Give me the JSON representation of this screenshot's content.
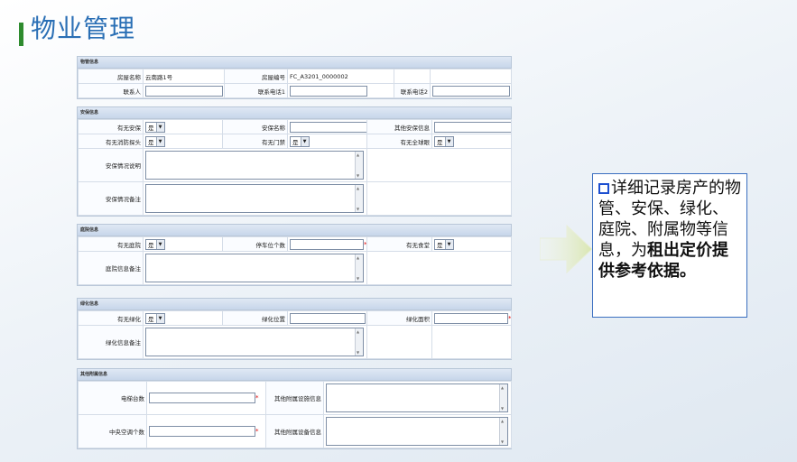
{
  "page": {
    "title": "物业管理"
  },
  "callout": {
    "text": "详细记录房产的物管、安保、绿化、庭院、附属物等信息，为",
    "bold": "租出定价提供参考依据。"
  },
  "sections": {
    "property": {
      "header": "物管信息",
      "house_name_label": "房屋名称",
      "house_name_value": "云南路1号",
      "house_no_label": "房屋编号",
      "house_no_value": "FC_A3201_0000002",
      "contact_label": "联系人",
      "phone1_label": "联系电话1",
      "phone2_label": "联系电话2"
    },
    "security": {
      "header": "安保信息",
      "has_security_label": "有无安保",
      "has_security_value": "是",
      "security_name_label": "安保名称",
      "other_security_label": "其他安保信息",
      "fire_hose_label": "有无消防探头",
      "fire_hose_value": "是",
      "gate_label": "有无门禁",
      "gate_value": "是",
      "sphere_label": "有无全球眼",
      "sphere_value": "是",
      "desc_label": "安保情况说明",
      "note_label": "安保情况备注"
    },
    "yard": {
      "header": "庭院信息",
      "has_yard_label": "有无庭院",
      "has_yard_value": "是",
      "parking_label": "停车位个数",
      "canteen_label": "有无食堂",
      "canteen_value": "是",
      "note_label": "庭院信息备注"
    },
    "green": {
      "header": "绿化信息",
      "has_green_label": "有无绿化",
      "has_green_value": "是",
      "location_label": "绿化位置",
      "area_label": "绿化面积",
      "note_label": "绿化信息备注"
    },
    "other": {
      "header": "其他附属信息",
      "elevator_label": "电梯台数",
      "other_facility_label": "其他附属设施信息",
      "ac_label": "中央空调个数",
      "other_equipment_label": "其他附属设备信息"
    }
  }
}
